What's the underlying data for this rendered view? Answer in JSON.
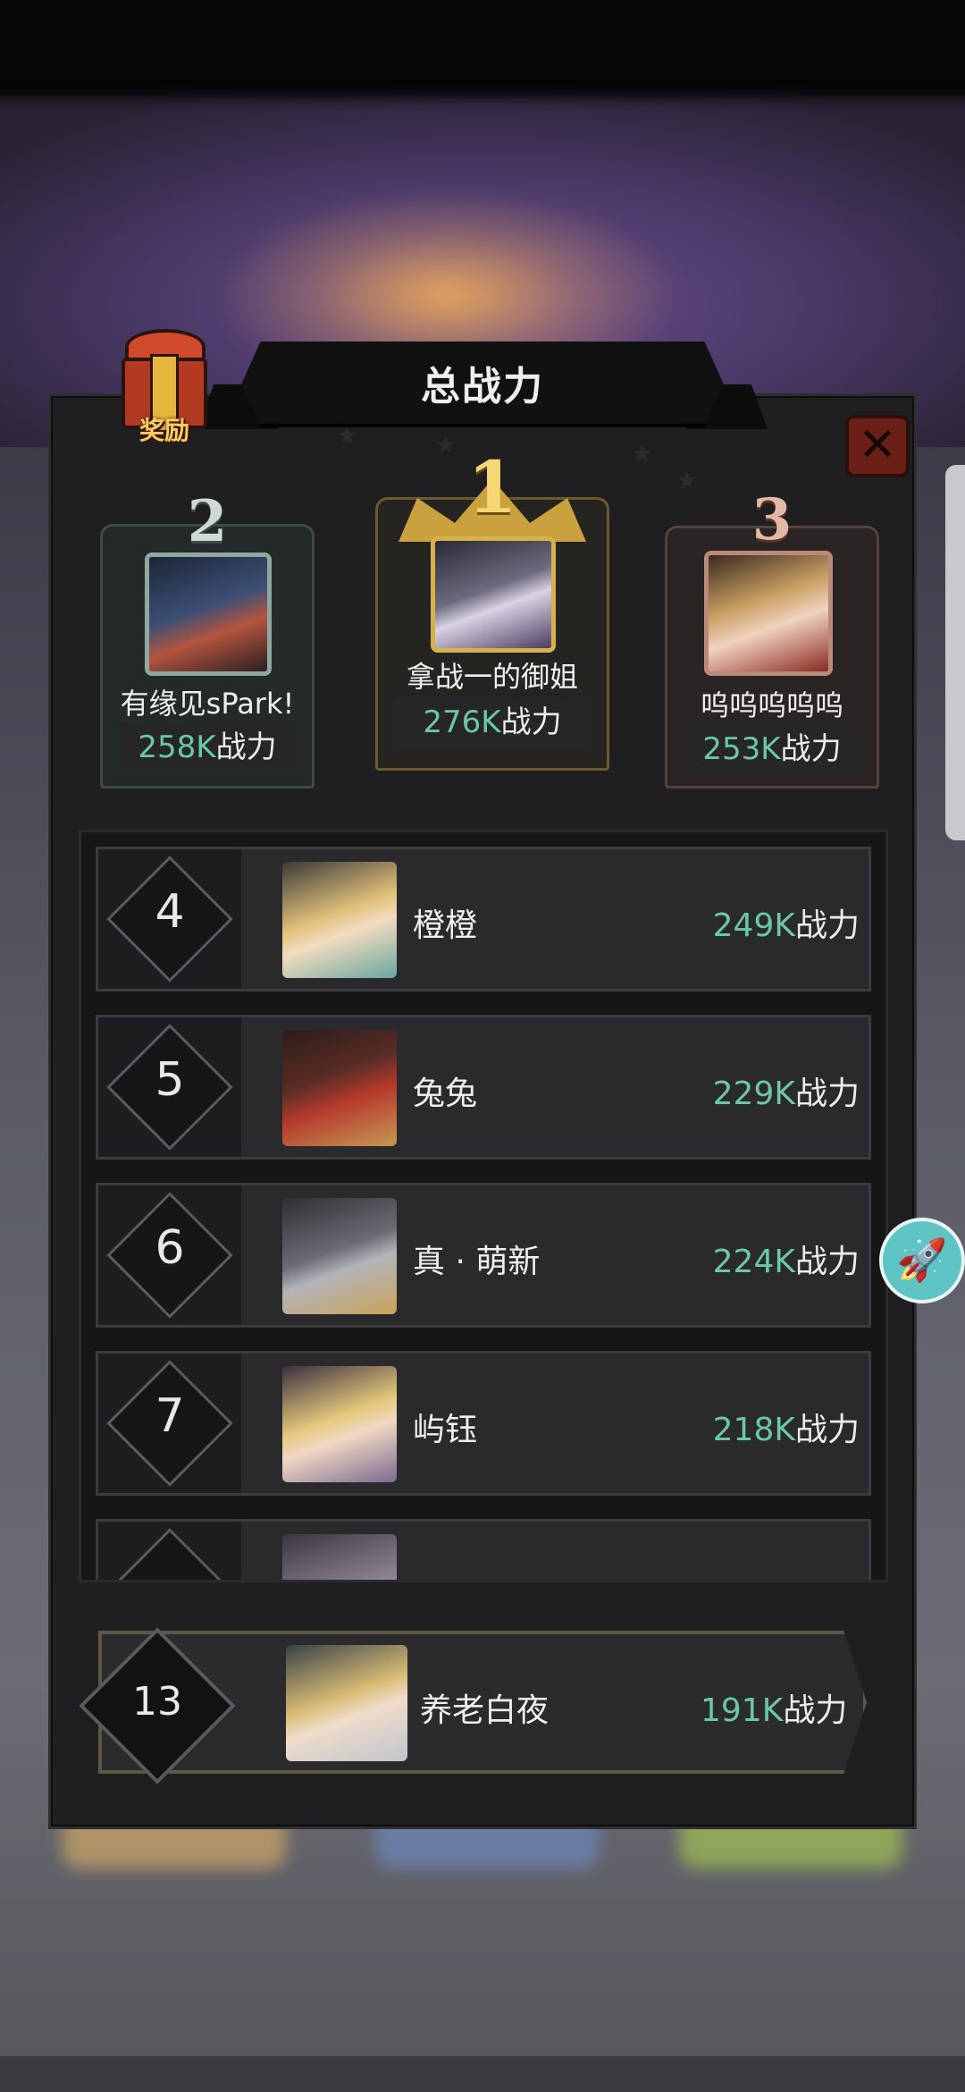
{
  "title": "总战力",
  "reward_label": "奖励",
  "icons": {
    "gift": "gift-box-icon",
    "close": "close-icon",
    "rocket": "rocket-icon",
    "crown": "crown-icon"
  },
  "colors": {
    "power_value": "#6cc7a6",
    "gold": "#c9a23f",
    "silver": "#8aa6a0",
    "bronze": "#b07a68"
  },
  "podium": [
    {
      "rank": "2",
      "name": "有缘见sPark!",
      "power_value": "258K",
      "power_unit": "战力"
    },
    {
      "rank": "1",
      "name": "拿战一的御姐",
      "power_value": "276K",
      "power_unit": "战力"
    },
    {
      "rank": "3",
      "name": "呜呜呜呜呜",
      "power_value": "253K",
      "power_unit": "战力"
    }
  ],
  "list": [
    {
      "rank": "4",
      "name": "橙橙",
      "power_value": "249K",
      "power_unit": "战力"
    },
    {
      "rank": "5",
      "name": "兔兔",
      "power_value": "229K",
      "power_unit": "战力"
    },
    {
      "rank": "6",
      "name": "真 · 萌新",
      "power_value": "224K",
      "power_unit": "战力"
    },
    {
      "rank": "7",
      "name": "屿钰",
      "power_value": "218K",
      "power_unit": "战力"
    }
  ],
  "self": {
    "rank": "13",
    "name": "养老白夜",
    "power_value": "191K",
    "power_unit": "战力"
  }
}
